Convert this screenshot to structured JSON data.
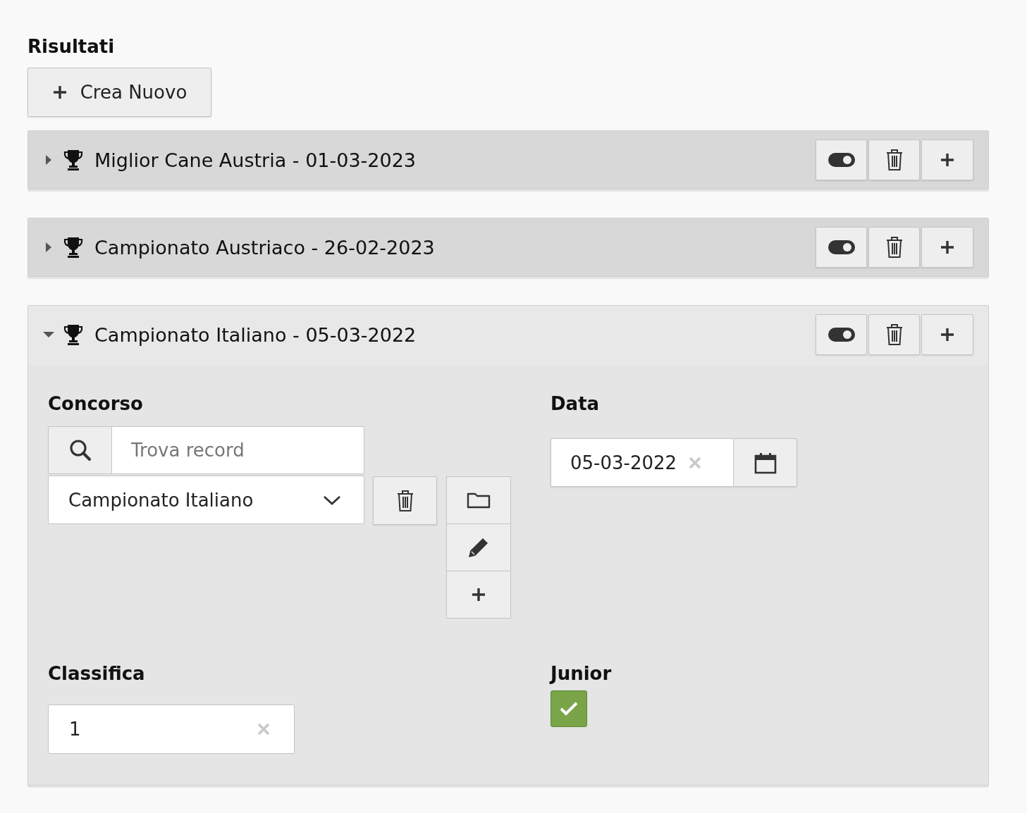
{
  "section_title": "Risultati",
  "create_button": {
    "label": "Crea Nuovo"
  },
  "records": [
    {
      "title": "Miglior Cane Austria - 01-03-2023",
      "expanded": false
    },
    {
      "title": "Campionato Austriaco - 26-02-2023",
      "expanded": false
    },
    {
      "title": "Campionato Italiano - 05-03-2022",
      "expanded": true,
      "concorso": {
        "label": "Concorso",
        "placeholder": "Trova record",
        "value": "Campionato Italiano"
      },
      "data": {
        "label": "Data",
        "value": "05-03-2022"
      },
      "classifica": {
        "label": "Classifica",
        "value": "1"
      },
      "junior": {
        "label": "Junior",
        "checked": true
      }
    }
  ]
}
